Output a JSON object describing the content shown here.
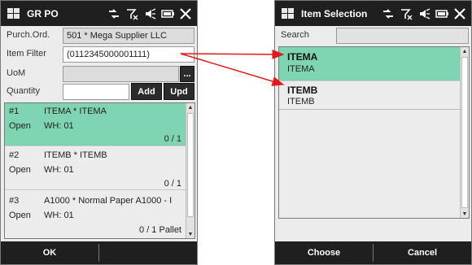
{
  "left": {
    "title": "GR PO",
    "purch_label": "Purch.Ord.",
    "purch_value": "501 * Mega Supplier LLC",
    "filter_label": "Item Filter",
    "filter_value": "(0112345000001111)",
    "uom_label": "UoM",
    "uom_button": "...",
    "qty_label": "Quantity",
    "add_button": "Add",
    "upd_button": "Upd",
    "items": [
      {
        "num": "#1",
        "name": "ITEMA * ITEMA",
        "status": "Open",
        "wh": "WH: 01",
        "qty": "0 / 1"
      },
      {
        "num": "#2",
        "name": "ITEMB * ITEMB",
        "status": "Open",
        "wh": "WH: 01",
        "qty": "0 / 1"
      },
      {
        "num": "#3",
        "name": "A1000 * Normal Paper A1000 - I",
        "status": "Open",
        "wh": "WH: 01",
        "qty": "0 / 1 Pallet"
      }
    ],
    "softkeys": [
      "OK",
      ""
    ]
  },
  "right": {
    "title": "Item Selection",
    "search_label": "Search",
    "items": [
      {
        "code": "ITEMA",
        "name": "ITEMA"
      },
      {
        "code": "ITEMB",
        "name": "ITEMB"
      }
    ],
    "softkeys": [
      "Choose",
      "Cancel"
    ]
  },
  "colors": {
    "selected_row": "#7fd4b2",
    "title_bar": "#1f1f1f",
    "arrow": "#e0191d"
  },
  "icons": [
    "windows-logo-icon",
    "signal-icon",
    "no-signal-icon",
    "volume-icon",
    "battery-icon",
    "close-icon"
  ]
}
